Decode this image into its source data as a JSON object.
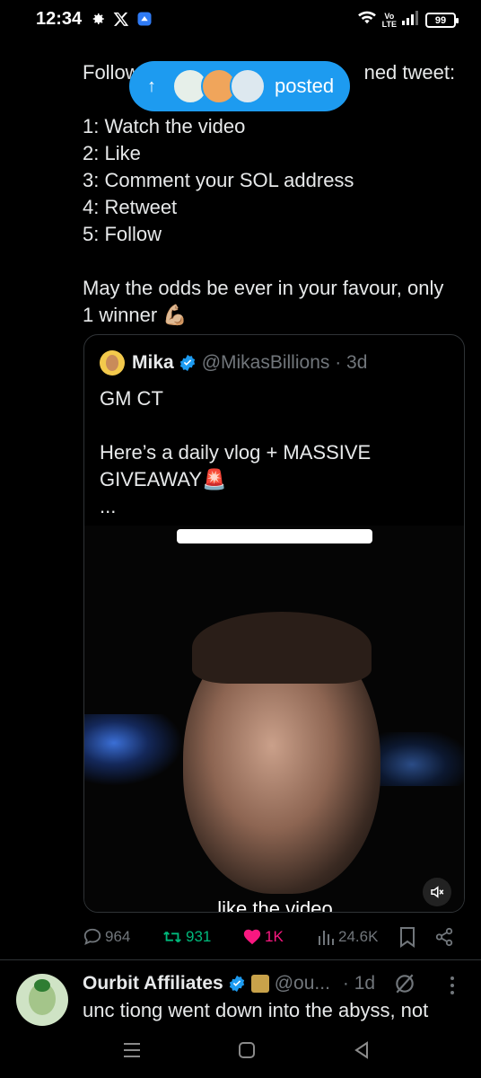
{
  "status_bar": {
    "time": "12:34",
    "volte_top": "Vo",
    "volte_bottom": "LTE",
    "battery": "99"
  },
  "tweet": {
    "lines": [
      "Follow",
      "",
      "1: Watch the video",
      "2: Like",
      "3: Comment your SOL address",
      "4: Retweet",
      "5: Follow",
      "",
      "May the odds be ever in your favour, only",
      "1 winner 💪🏼"
    ],
    "line1_tail": "ned tweet:"
  },
  "posted_pill": {
    "arrow": "↑",
    "label": "posted"
  },
  "quote": {
    "name": "Mika",
    "handle": "@MikasBillions · 3d",
    "lines": [
      "GM CT",
      "",
      "Here’s a daily vlog + MASSIVE",
      "GIVEAWAY🚨",
      "..."
    ],
    "video_caption": "like the video"
  },
  "actions": {
    "replies": "964",
    "retweets": "931",
    "likes": "1K",
    "views": "24.6K"
  },
  "next_tweet": {
    "name": "Ourbit Affiliates",
    "handle": "@ou...",
    "time": "· 1d",
    "text": "unc tiong went down into the abyss, not"
  },
  "colors": {
    "accent": "#1d9bf0",
    "retweet": "#00ba7c",
    "like": "#f91880",
    "muted": "#71767b"
  },
  "icons": [
    "settings-icon",
    "x-logo-icon",
    "app-icon",
    "wifi-icon",
    "signal-icon",
    "battery-icon",
    "reply-icon",
    "retweet-icon",
    "like-icon",
    "views-icon",
    "bookmark-icon",
    "share-icon",
    "verified-icon",
    "grok-icon",
    "more-icon",
    "mute-icon",
    "menu-nav-icon",
    "home-nav-icon",
    "back-nav-icon"
  ]
}
